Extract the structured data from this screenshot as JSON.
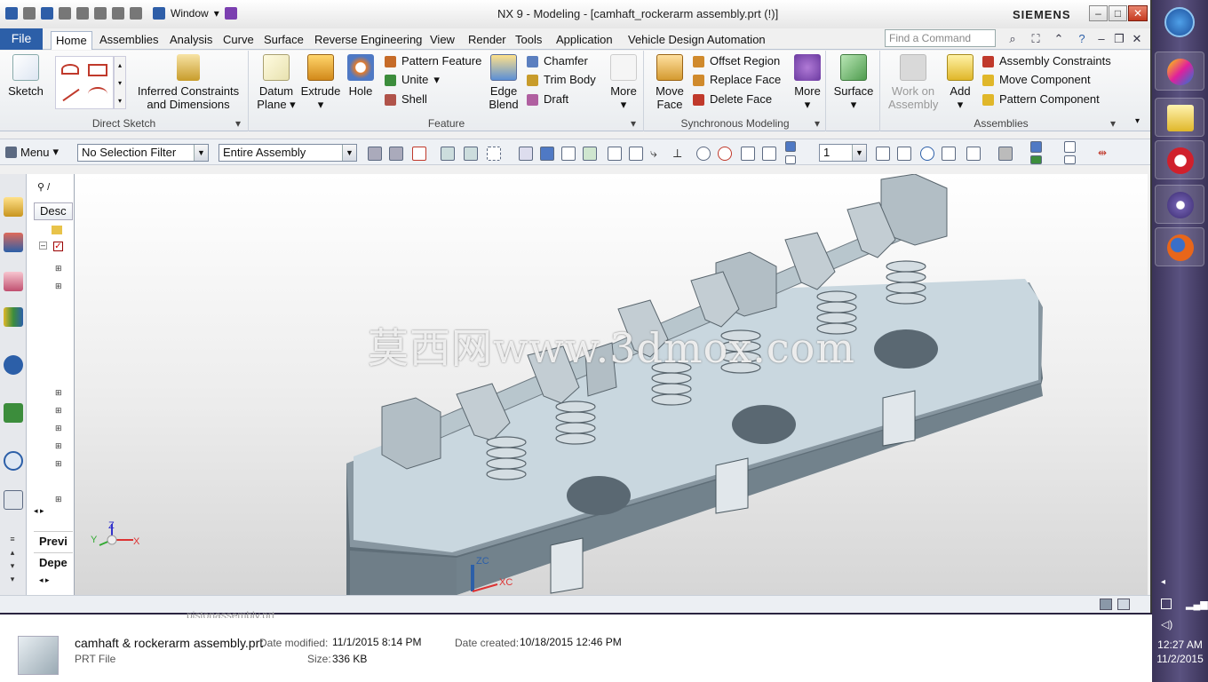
{
  "title_bar": {
    "window_menu": "Window",
    "title": "NX 9 - Modeling - [camhaft_rockerarm assembly.prt  (!)]",
    "brand": "SIEMENS"
  },
  "tabs": {
    "file": "File",
    "items": [
      "Home",
      "Assemblies",
      "Analysis",
      "Curve",
      "Surface",
      "Reverse Engineering",
      "View",
      "Render",
      "Tools",
      "Application",
      "Vehicle Design Automation"
    ],
    "active": "Home",
    "find_placeholder": "Find a Command"
  },
  "ribbon": {
    "sketch": "Sketch",
    "inferred": "Inferred Constraints",
    "inferred2": "and Dimensions",
    "direct_sketch": "Direct Sketch",
    "datum": "Datum",
    "datum2": "Plane",
    "extrude": "Extrude",
    "hole": "Hole",
    "pattern_feature": "Pattern Feature",
    "unite": "Unite",
    "shell": "Shell",
    "edge": "Edge",
    "blend": "Blend",
    "chamfer": "Chamfer",
    "trim_body": "Trim Body",
    "draft": "Draft",
    "more1": "More",
    "feature": "Feature",
    "move": "Move",
    "face": "Face",
    "offset_region": "Offset Region",
    "replace_face": "Replace Face",
    "delete_face": "Delete Face",
    "more2": "More",
    "synchronous": "Synchronous Modeling",
    "surface": "Surface",
    "work_on": "Work on",
    "assembly": "Assembly",
    "add": "Add",
    "assembly_constraints": "Assembly Constraints",
    "move_component": "Move Component",
    "pattern_component": "Pattern Component",
    "assemblies": "Assemblies"
  },
  "selection_bar": {
    "menu": "Menu",
    "filter": "No Selection Filter",
    "scope": "Entire Assembly",
    "count": "1"
  },
  "nav_panel": {
    "header": "Desc",
    "prev": "Previ",
    "dep": "Depe"
  },
  "viewport": {
    "watermark": "莫西网www.3dmox.com",
    "axis_x": "X",
    "axis_y": "Y",
    "axis_z": "Z",
    "zc": "ZC",
    "xc": "XC"
  },
  "explorer": {
    "prev_row": "pistonassembly.prt",
    "filename": "camhaft & rockerarm assembly.prt",
    "type": "PRT File",
    "date_modified_label": "Date modified:",
    "date_modified": "11/1/2015 8:14 PM",
    "date_created_label": "Date created:",
    "date_created": "10/18/2015 12:46 PM",
    "size_label": "Size:",
    "size": "336 KB"
  },
  "taskbar": {
    "time": "12:27 AM",
    "date": "11/2/2015"
  }
}
